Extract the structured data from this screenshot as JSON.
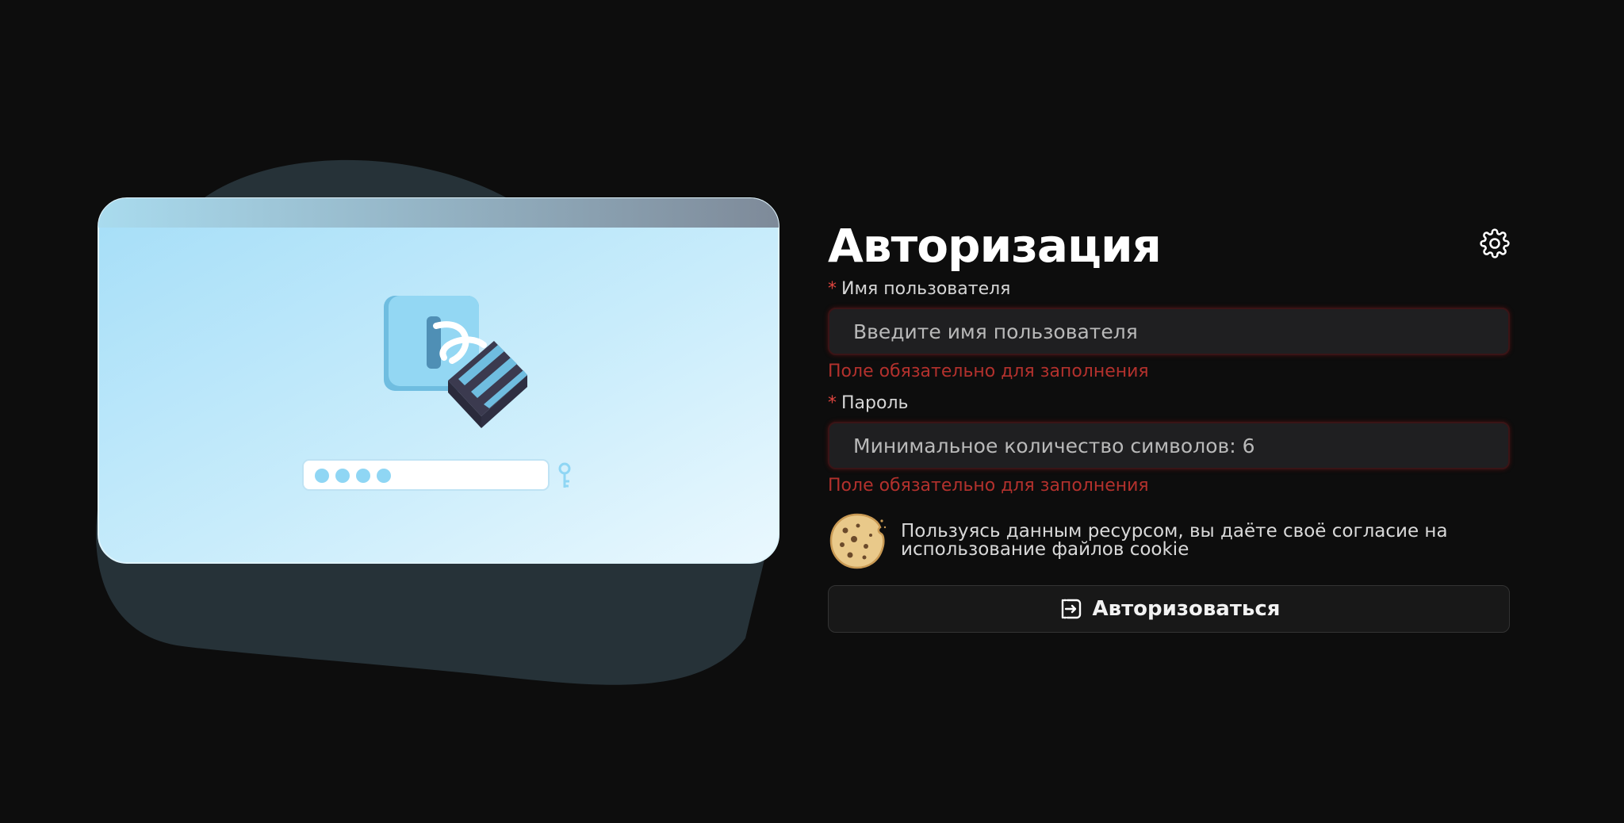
{
  "auth": {
    "title": "Авторизация",
    "username": {
      "label": "Имя пользователя",
      "required_mark": "*",
      "placeholder": "Введите имя пользователя",
      "error": "Поле обязательно для заполнения"
    },
    "password": {
      "label": "Пароль",
      "required_mark": "*",
      "placeholder": "Минимальное количество символов: 6",
      "error": "Поле обязательно для заполнения"
    },
    "cookie_notice": "Пользуясь данным ресурсом, вы даёте своё согласие на использование файлов cookie",
    "submit_label": "Авторизоваться"
  },
  "icons": {
    "settings": "gear-icon",
    "cookie": "cookie-icon",
    "submit": "login-icon",
    "illustration_lock": "padlock-icon",
    "illustration_key": "key-icon"
  },
  "colors": {
    "background": "#0d0d0d",
    "error": "#b3312d",
    "required": "#e0453f",
    "input_bg": "#1f1f21",
    "illustration_panel": "#bfe9fb",
    "blob": "#263238"
  }
}
